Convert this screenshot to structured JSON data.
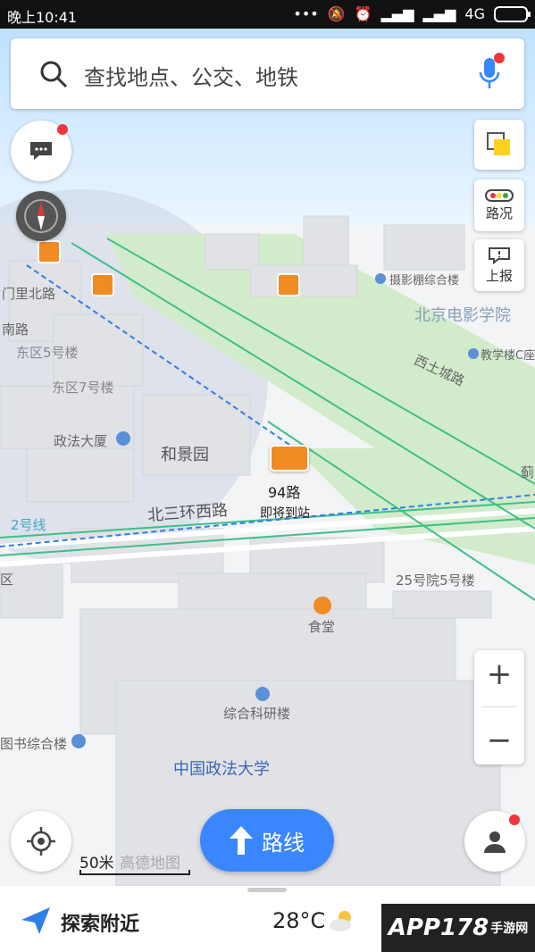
{
  "status": {
    "time": "晚上10:41",
    "network": "4G"
  },
  "search": {
    "placeholder": "查找地点、公交、地铁"
  },
  "right_buttons": {
    "traffic": "路况",
    "report": "上报"
  },
  "map_labels": {
    "mentu": "门里北路",
    "nan": "南路",
    "dongqu5": "东区5号楼",
    "dongqu7": "东区7号楼",
    "zhengfa": "政法大厦",
    "heijing": "和景园",
    "sheying": "摄影棚综合楼",
    "dianying": "北京电影学院",
    "xitucheng": "西土城路",
    "jiaoxue": "教学楼C座",
    "bus_route": "94路",
    "bus_status": "即将到站",
    "beisanhuan": "北三环西路",
    "line2": "2号线",
    "qu": "区",
    "yuan25": "25号院5号楼",
    "shitang": "食堂",
    "zonghe": "综合科研楼",
    "tushu": "图书综合楼",
    "daxue": "中国政法大学",
    "gaode": "高德地图",
    "ji": "蓟"
  },
  "scale": {
    "label": "50米"
  },
  "route_button": {
    "label": "路线"
  },
  "bottom": {
    "explore": "探索附近",
    "temperature": "28°C"
  },
  "watermark": {
    "main": "APP178",
    "sub": "手游网"
  }
}
